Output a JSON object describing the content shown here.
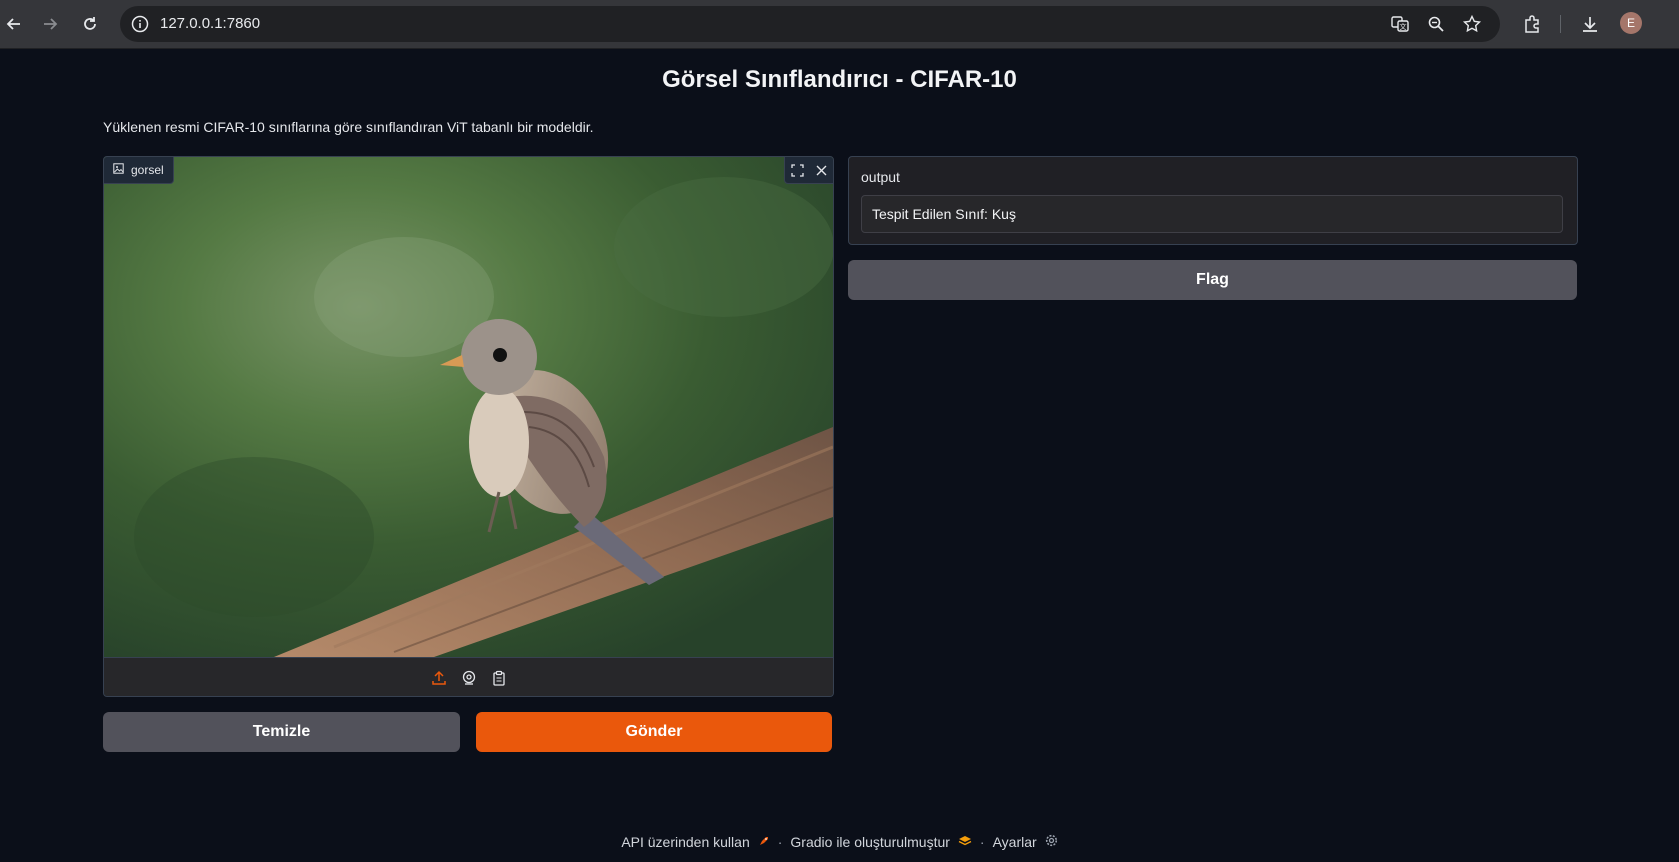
{
  "browser": {
    "url": "127.0.0.1:7860",
    "profile_initial": "E",
    "icons": [
      "back-icon",
      "forward-icon",
      "reload-icon",
      "info-icon",
      "translate-icon",
      "zoom-icon",
      "star-icon",
      "extensions-icon",
      "download-icon"
    ]
  },
  "app": {
    "title": "Görsel Sınıflandırıcı - CIFAR-10",
    "description": "Yüklenen resmi CIFAR-10 sınıflarına göre sınıflandıran ViT tabanlı bir modeldir."
  },
  "image_input": {
    "label": "gorsel",
    "icons": [
      "image-icon",
      "fullscreen-icon",
      "close-icon",
      "upload-icon",
      "webcam-icon",
      "clipboard-icon"
    ]
  },
  "buttons": {
    "clear": "Temizle",
    "submit": "Gönder",
    "flag": "Flag"
  },
  "output": {
    "label": "output",
    "value": "Tespit Edilen Sınıf: Kuş"
  },
  "footer": {
    "api": "API üzerinden kullan",
    "built_with": "Gradio ile oluşturulmuştur",
    "settings": "Ayarlar",
    "separator": "·"
  },
  "colors": {
    "primary": "#ea580c",
    "secondary": "#52525b",
    "background": "#0b0f19"
  }
}
